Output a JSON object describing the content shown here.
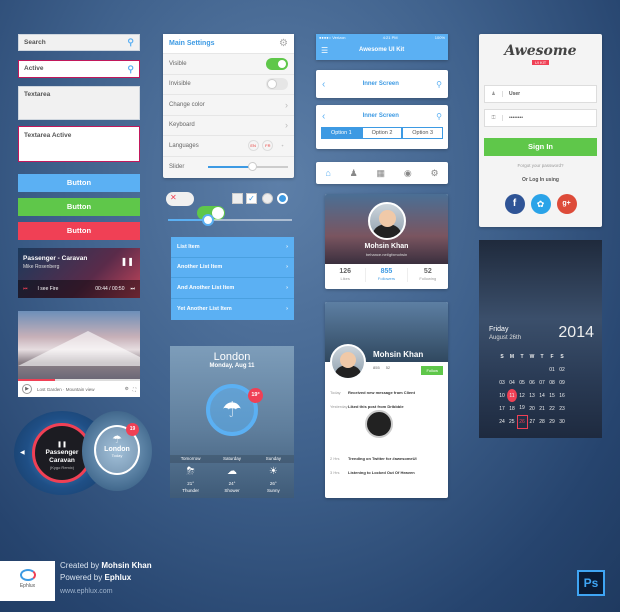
{
  "colors": {
    "blue": "#5bb0f3",
    "green": "#5fc74a",
    "red": "#f04055",
    "accent": "#2196f3"
  },
  "inputs": {
    "search": "Search",
    "active": "Active",
    "textarea": "Textarea",
    "textarea_active": "Textarea Active"
  },
  "buttons": {
    "b1": "Button",
    "b2": "Button",
    "b3": "Button"
  },
  "player": {
    "title": "Passenger - Caravan",
    "artist": "Mike Rosenberg",
    "track": "I see Fire",
    "time": "00:44 / 00:50"
  },
  "video": {
    "caption": "Lost Garden · Mountain view"
  },
  "round_player": {
    "title": "Passenger Caravan",
    "sub": "(Kygo Remix)"
  },
  "round_weather": {
    "city": "London",
    "sub": "Today",
    "badge": "19"
  },
  "settings": {
    "title": "Main Settings",
    "visible": "Visible",
    "invisible": "Invisible",
    "change_color": "Change color",
    "keyboard": "Keyboard",
    "languages": "Languages",
    "slider": "Slider",
    "lang_en": "EN",
    "lang_fr": "FR",
    "lang_add": "+"
  },
  "list": [
    "List Item",
    "Another List Item",
    "And Another List Item",
    "Yet Another List Item"
  ],
  "weather": {
    "city": "London",
    "date": "Monday, Aug 11",
    "badge": "19°",
    "days": [
      "Tomorrow",
      "Saturday",
      "Sunday"
    ],
    "temps": [
      "21°",
      "24°",
      "26°"
    ],
    "conds": [
      "Thunder",
      "Shower",
      "Sunny"
    ]
  },
  "ios": {
    "carrier": "●●●●○ Verizon",
    "time": "4:21 PM",
    "battery": "100%",
    "title": "Awesome UI Kit",
    "inner1": "Inner Screen",
    "inner2": "Inner Screen",
    "opts": [
      "Option 1",
      "Option 2",
      "Option 3"
    ]
  },
  "profile": {
    "name": "Mohsin Khan",
    "url": "behance.net/gfxmohsin",
    "stats": [
      {
        "n": "126",
        "l": "Likes"
      },
      {
        "n": "855",
        "l": "Followers"
      },
      {
        "n": "52",
        "l": "Following"
      }
    ]
  },
  "profile2": {
    "name": "Mohsin Khan",
    "followers": "855",
    "following": "52",
    "follow": "Follow",
    "feed": [
      {
        "t": "Today",
        "text": "Received new message from Client"
      },
      {
        "t": "Yesterday",
        "text": "Liked this post from Dribbble"
      },
      {
        "t": "2 Hrs",
        "text": "Trending on Twitter for #awesomeUI"
      },
      {
        "t": "3 Hrs",
        "text": "Listening to Locked Out Of Heaven"
      }
    ]
  },
  "login": {
    "brand": "Awesome",
    "tag": "UI KIT",
    "user": "User",
    "password": "••••••••",
    "signin": "Sign In",
    "forgot": "Forgot your password?",
    "or": "Or Log In using"
  },
  "calendar": {
    "weekday": "Friday",
    "date": "August 26th",
    "year": "2014",
    "days": [
      "S",
      "M",
      "T",
      "W",
      "T",
      "F",
      "S"
    ],
    "rows": [
      [
        "",
        "",
        "",
        "",
        "",
        "01",
        "02"
      ],
      [
        "03",
        "04",
        "05",
        "06",
        "07",
        "08",
        "09"
      ],
      [
        "10",
        "11",
        "12",
        "13",
        "14",
        "15",
        "16"
      ],
      [
        "17",
        "18",
        "19",
        "20",
        "21",
        "22",
        "23"
      ],
      [
        "24",
        "25",
        "26",
        "27",
        "28",
        "29",
        "30"
      ]
    ]
  },
  "footer": {
    "created": "Created by",
    "author": "Mohsin Khan",
    "powered": "Powered by",
    "company": "Ephlux",
    "site": "www.ephlux.com",
    "logo": "Ephlux",
    "ps": "Ps"
  }
}
